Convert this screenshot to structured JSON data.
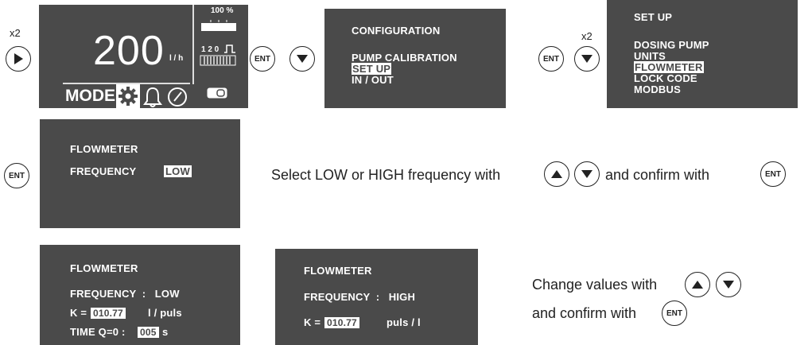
{
  "step1": {
    "repeat": "x2",
    "big_value": "200",
    "unit": "l / h",
    "percent": "100 %",
    "pulse": "1 2 0",
    "mode_label": "MODE"
  },
  "buttons": {
    "ent": "ENT"
  },
  "config_menu": {
    "title": "CONFIGURATION",
    "items": [
      "PUMP CALIBRATION",
      "SET UP",
      "IN / OUT"
    ]
  },
  "repeat2": "x2",
  "setup_menu": {
    "title": "SET UP",
    "items": [
      "DOSING  PUMP",
      "UNITS",
      "FLOWMETER",
      "LOCK CODE",
      "MODBUS"
    ]
  },
  "flowmeter_select": {
    "title": "FLOWMETER",
    "freq_label": "FREQUENCY",
    "freq_value": "LOW"
  },
  "instruction1": {
    "part1": "Select LOW or HIGH frequency with",
    "part2": "and confirm with"
  },
  "flow_low": {
    "title": "FLOWMETER",
    "freq": "FREQUENCY  :   LOW",
    "k_label": "K =",
    "k_value": "010.77",
    "k_unit": "l / puls",
    "time_label": "TIME Q=0 :",
    "time_value": "005",
    "time_unit": "s"
  },
  "flow_high": {
    "title": "FLOWMETER",
    "freq": "FREQUENCY  :   HIGH",
    "k_label": "K =",
    "k_value": "010.77",
    "k_unit": "puls / l"
  },
  "instruction2": {
    "line1": "Change values with",
    "line2": "and confirm with"
  },
  "colors": {
    "screen": "#4a4a4a",
    "text": "#ffffff",
    "ink": "#222222"
  }
}
